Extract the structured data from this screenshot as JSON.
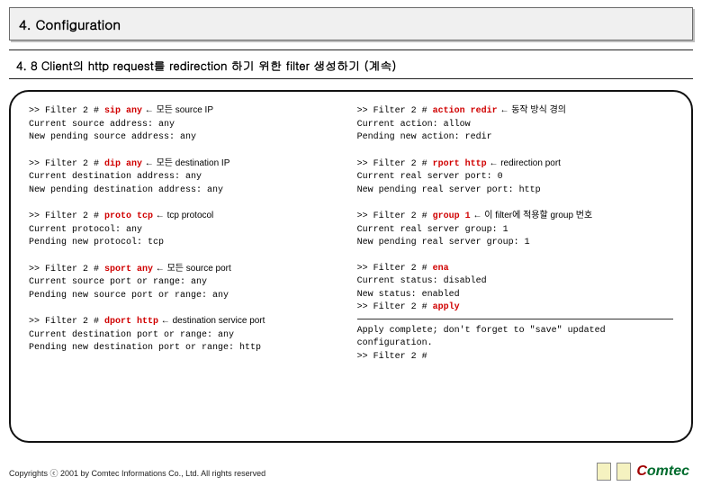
{
  "header": {
    "title": "4. Configuration"
  },
  "subheader": {
    "subtitle": "4. 8 Client의 http request를 redirection 하기 위한 filter 생성하기 (계속)"
  },
  "left": {
    "b1": {
      "l1_prompt": ">> Filter 2  # ",
      "l1_cmd": "sip any",
      "l1_note": "    ← 모든 source IP",
      "l2": "Current source address:        any",
      "l3": "New pending source address: any"
    },
    "b2": {
      "l1_prompt": ">> Filter 2  # ",
      "l1_cmd": "dip any",
      "l1_note": "    ← 모든 destination IP",
      "l2": "Current destination address:        any",
      "l3": "New pending destination address: any"
    },
    "b3": {
      "l1_prompt": ">> Filter 2  # ",
      "l1_cmd": "proto tcp",
      "l1_note": "    ← tcp protocol",
      "l2": "Current protocol:           any",
      "l3": "Pending new protocol:    tcp"
    },
    "b4": {
      "l1_prompt": ">> Filter 2  # ",
      "l1_cmd": "sport any",
      "l1_note": "    ← 모든 source port",
      "l2": "Current source port or range:     any",
      "l3": "Pending new source port or range:     any"
    },
    "b5": {
      "l1_prompt": ">> Filter 2  # ",
      "l1_cmd": "dport http",
      "l1_note": "    ← destination service port",
      "l2": "Current destination port or range:     any",
      "l3": "Pending new destination port or range:  http"
    }
  },
  "right": {
    "b1": {
      "l1_prompt": ">> Filter 2  # ",
      "l1_cmd": "action redir",
      "l1_note": "     ← 동작 방식 경의",
      "l2": "Current action: allow",
      "l3": "Pending new action:       redir"
    },
    "b2": {
      "l1_prompt": ">> Filter 2  # ",
      "l1_cmd": "rport http",
      "l1_note": "        ← redirection port",
      "l2": "Current real server port:        0",
      "l3": "New pending real server port:    http"
    },
    "b3": {
      "l1_prompt": ">> Filter 2  # ",
      "l1_cmd": "group 1",
      "l1_note": "        ← 이 filter에 적용할 group 번호",
      "l2": "Current real server group:        1",
      "l3": "New pending real server group: 1"
    },
    "b4": {
      "l1_prompt": ">> Filter 2  # ",
      "l1_cmd": "ena",
      "l2": "Current status: disabled",
      "l3": "New status:       enabled",
      "l4_prompt": ">> Filter 2  # ",
      "l4_cmd": "apply"
    },
    "b5": {
      "l1": "Apply complete; don't forget to \"save\" updated configuration.",
      "l2": ">> Filter 2  #"
    }
  },
  "footer": {
    "copyright": "Copyrights ⓒ 2001 by Comtec Informations Co., Ltd. All rights reserved"
  },
  "logo": {
    "swoosh": "C",
    "text": "omtec"
  }
}
